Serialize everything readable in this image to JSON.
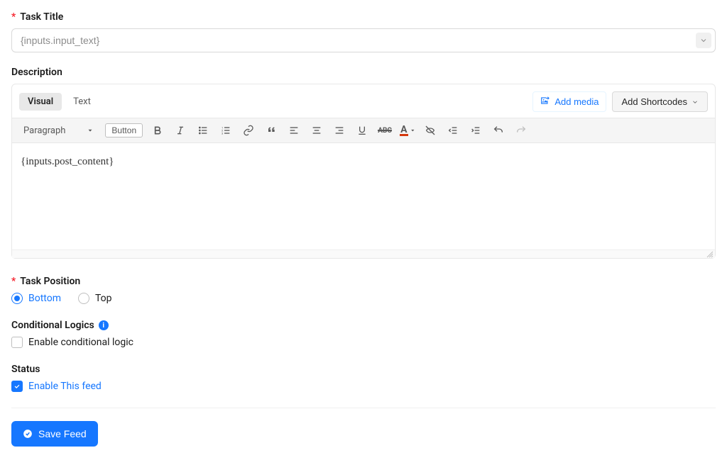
{
  "taskTitle": {
    "label": "Task Title",
    "value": "{inputs.input_text}"
  },
  "description": {
    "label": "Description",
    "tabs": {
      "visual": "Visual",
      "text": "Text"
    },
    "addMedia": "Add media",
    "addShortcodes": "Add Shortcodes",
    "paragraph": "Paragraph",
    "buttonLabel": "Button",
    "content": "{inputs.post_content}"
  },
  "taskPosition": {
    "label": "Task Position",
    "options": {
      "bottom": "Bottom",
      "top": "Top"
    },
    "selected": "bottom"
  },
  "conditional": {
    "label": "Conditional Logics",
    "checkboxLabel": "Enable conditional logic",
    "checked": false
  },
  "status": {
    "label": "Status",
    "checkboxLabel": "Enable This feed",
    "checked": true
  },
  "actions": {
    "save": "Save Feed"
  }
}
